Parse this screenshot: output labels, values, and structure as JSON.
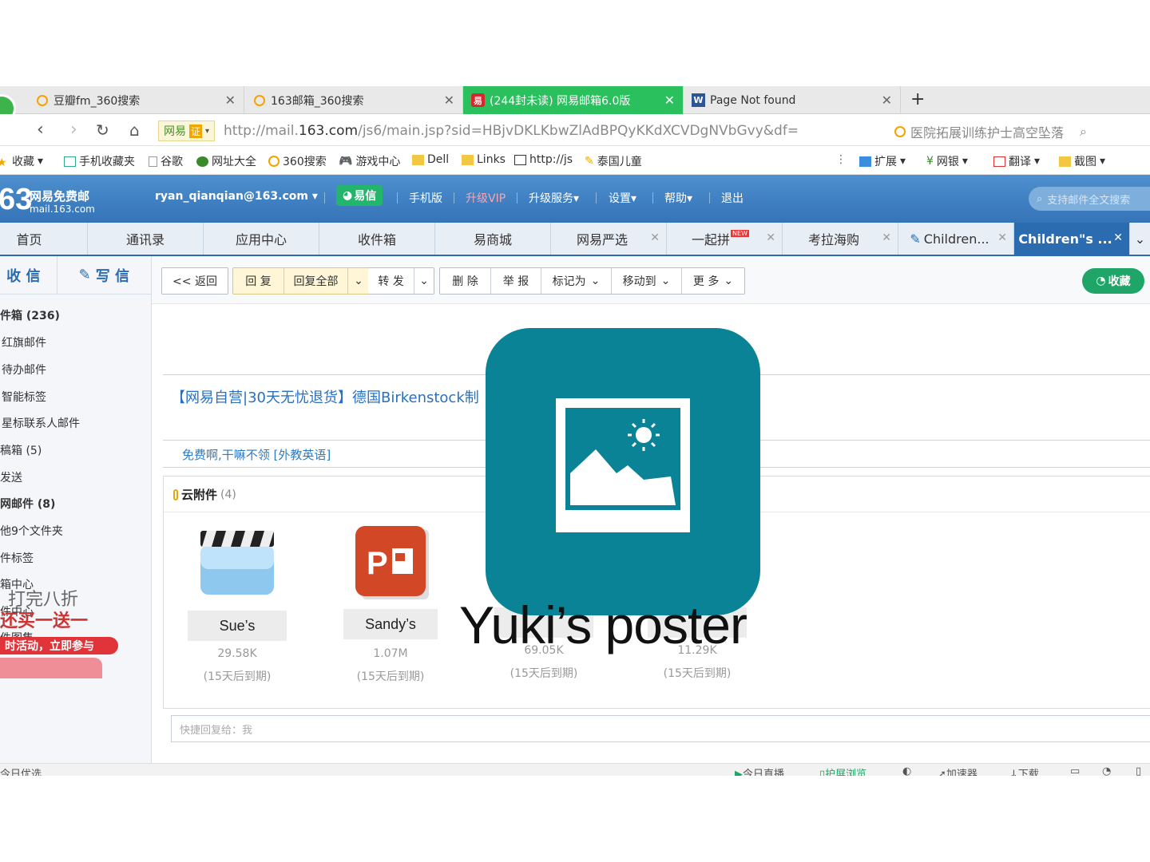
{
  "browser": {
    "tabs": [
      {
        "label": "豆瓣fm_360搜索"
      },
      {
        "label": "163邮箱_360搜索"
      },
      {
        "label": "(244封未读) 网易邮箱6.0版"
      },
      {
        "label": "Page Not found"
      }
    ],
    "new_tab": "+",
    "site_badge": "网易",
    "cert_label": "证",
    "url_prefix": "http://mail.",
    "url_domain": "163.com",
    "url_rest": "/js6/main.jsp?sid=HBjvDKLKbwZlAdBPQyKKdXCVDgNVbGvy&df=",
    "address_search": "医院拓展训练护士高空坠落",
    "bookmarks": [
      "收藏",
      "手机收藏夹",
      "谷歌",
      "网址大全",
      "360搜索",
      "游戏中心",
      "Dell",
      "Links",
      "http://js",
      "泰国儿童"
    ],
    "right_tools": [
      "扩展",
      "网银",
      "翻译",
      "截图"
    ]
  },
  "mail_header": {
    "logo_number": "63",
    "logo_title": "网易免费邮",
    "logo_domain": "mail.163.com",
    "account": "ryan_qianqian@163.com",
    "yixin": "易信",
    "nav": [
      "手机版",
      "升级VIP",
      "升级服务",
      "设置",
      "帮助",
      "退出"
    ],
    "search_placeholder": "支持邮件全文搜索"
  },
  "module_tabs": [
    {
      "label": "首页"
    },
    {
      "label": "通讯录"
    },
    {
      "label": "应用中心"
    },
    {
      "label": "收件箱"
    },
    {
      "label": "易商城"
    },
    {
      "label": "网易严选"
    },
    {
      "label": "一起拼"
    },
    {
      "label": "考拉海购"
    },
    {
      "label": "Children..."
    },
    {
      "label": "Children\"s ..."
    }
  ],
  "new_badge": "NEW",
  "sidebar": {
    "receive": "收 信",
    "compose": "写 信",
    "items": [
      "件箱 (236)",
      "红旗邮件",
      "待办邮件",
      "智能标签",
      "星标联系人邮件",
      "稿箱 (5)",
      "发送",
      "网邮件 (8)",
      "他9个文件夹",
      "件标签",
      "箱中心",
      "件中心",
      "件图集"
    ],
    "promo_line1": "打完八折",
    "promo_line2": "还买一送一",
    "promo_line3": "时活动，立即参与"
  },
  "toolbar": {
    "back": "<< 返回",
    "reply": "回 复",
    "reply_all": "回复全部",
    "forward": "转 发",
    "delete": "删 除",
    "report": "举 报",
    "mark_as": "标记为",
    "move_to": "移动到",
    "more": "更 多",
    "favorite": "收藏"
  },
  "content": {
    "ad_text": "【网易自营|30天无忧退货】德国Birkenstock制",
    "free_link": "免费啊,干嘛不领 [外教英语]",
    "attachments_title": "云附件",
    "attachments_count": "(4)",
    "attachments": [
      {
        "name": "Sue’s",
        "size": "29.58K",
        "expiry": "(15天后到期)"
      },
      {
        "name": "Sandy’s",
        "size": "1.07M",
        "expiry": "(15天后到期)"
      },
      {
        "name": "",
        "size": "69.05K",
        "expiry": "(15天后到期)"
      },
      {
        "name": "",
        "size": "11.29K",
        "expiry": "(15天后到期)"
      }
    ],
    "quick_reply_placeholder": "快捷回复给：我"
  },
  "statusbar": {
    "left": "今日优选",
    "items": [
      "今日直播",
      "护屏浏览",
      "加速器",
      "下载"
    ]
  },
  "overlay": {
    "title": "Yuki’s poster",
    "icon": "image-placeholder-icon",
    "color": "#0a8396"
  }
}
